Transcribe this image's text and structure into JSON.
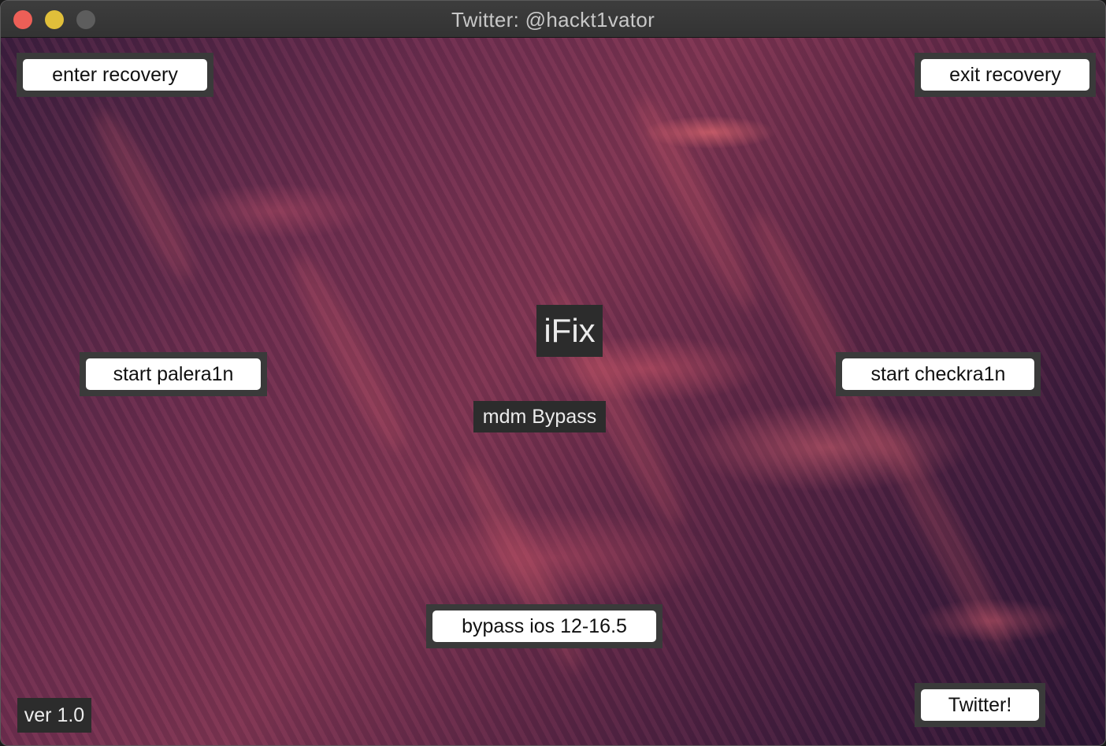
{
  "window": {
    "title": "Twitter: @hackt1vator"
  },
  "buttons": {
    "enter_recovery": "enter recovery",
    "exit_recovery": "exit recovery",
    "start_palera1n": "start palera1n",
    "start_checkra1n": "start checkra1n",
    "bypass": "bypass ios 12-16.5",
    "twitter": "Twitter!"
  },
  "labels": {
    "app_name": "iFix",
    "mdm": "mdm Bypass",
    "version": "ver 1.0"
  },
  "colors": {
    "close": "#ed5f57",
    "minimize": "#e0bf3a",
    "zoom_disabled": "#5d5d5d",
    "button_bg": "#ffffff",
    "label_bg": "#2c2c2c"
  }
}
